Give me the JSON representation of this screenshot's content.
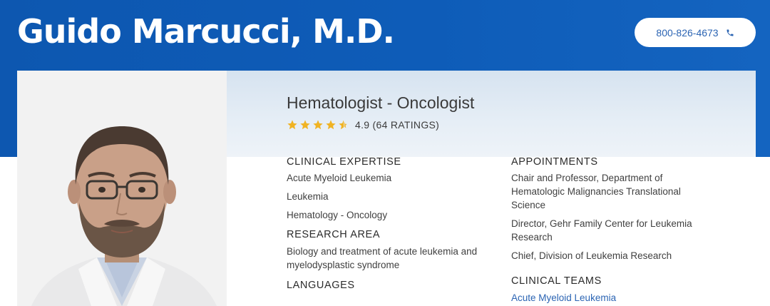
{
  "header": {
    "doctor_name": "Guido Marcucci, M.D.",
    "phone_number": "800-826-4673",
    "phone_icon": "phone-icon"
  },
  "profile": {
    "specialty": "Hematologist - Oncologist",
    "rating": {
      "value": 4.9,
      "max": 5,
      "star_color": "#f0b323",
      "text": "4.9 (64 RATINGS)"
    }
  },
  "clinical_expertise": {
    "heading": "CLINICAL EXPERTISE",
    "items": [
      "Acute Myeloid Leukemia",
      "Leukemia",
      "Hematology - Oncology"
    ]
  },
  "research_area": {
    "heading": "RESEARCH AREA",
    "text": "Biology and treatment of acute leukemia and myelodysplastic syndrome"
  },
  "languages": {
    "heading": "LANGUAGES"
  },
  "appointments": {
    "heading": "APPOINTMENTS",
    "items": [
      "Chair and Professor, Department of Hematologic Malignancies Translational Science",
      "Director, Gehr Family Center for Leukemia Research",
      "Chief, Division of Leukemia Research"
    ]
  },
  "clinical_teams": {
    "heading": "CLINICAL TEAMS",
    "items": [
      "Acute Myeloid Leukemia"
    ]
  },
  "colors": {
    "hero_blue": "#0e5cb8",
    "link_blue": "#2b64b3",
    "star_gold": "#f0b323"
  }
}
